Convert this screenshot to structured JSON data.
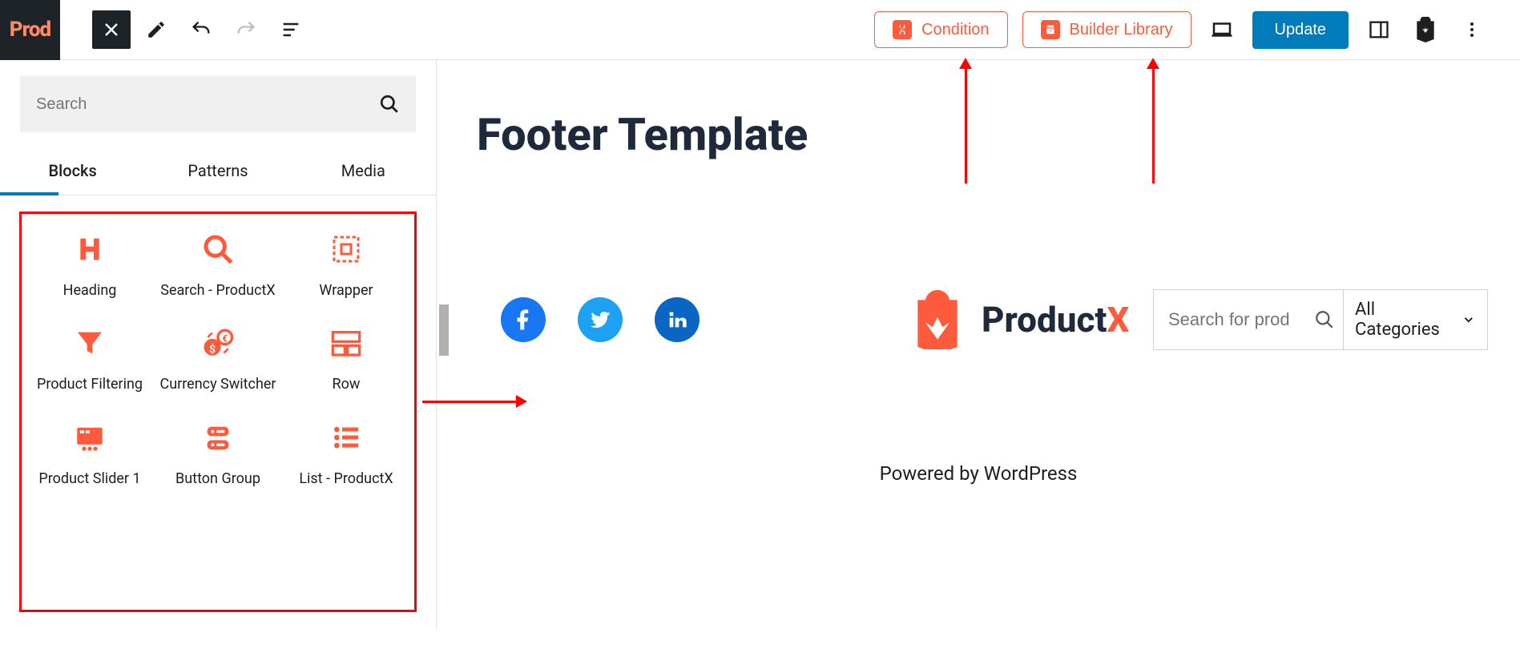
{
  "topbar": {
    "logo_text": "Prod",
    "close_label": "Close",
    "pencil_label": "Edit",
    "undo_label": "Undo",
    "redo_label": "Redo",
    "listview_label": "List view",
    "condition_label": "Condition",
    "library_label": "Builder Library",
    "device_label": "Desktop view",
    "update_label": "Update",
    "settings_label": "Settings",
    "bag_label": "ProductX",
    "more_label": "Options"
  },
  "inserter": {
    "search_placeholder": "Search",
    "tabs": {
      "blocks": "Blocks",
      "patterns": "Patterns",
      "media": "Media"
    },
    "blocks": [
      {
        "label": "Heading",
        "icon": "heading-icon"
      },
      {
        "label": "Search - ProductX",
        "icon": "search-block-icon"
      },
      {
        "label": "Wrapper",
        "icon": "wrapper-icon"
      },
      {
        "label": "Product Filtering",
        "icon": "filter-icon"
      },
      {
        "label": "Currency Switcher",
        "icon": "currency-icon"
      },
      {
        "label": "Row",
        "icon": "row-icon"
      },
      {
        "label": "Product Slider 1",
        "icon": "slider-icon"
      },
      {
        "label": "Button Group",
        "icon": "buttongroup-icon"
      },
      {
        "label": "List - ProductX",
        "icon": "list-icon"
      }
    ]
  },
  "canvas": {
    "title": "Footer Template",
    "brand": "ProductX",
    "search_placeholder": "Search for prod",
    "category_label": "All Categories",
    "powered": "Powered by WordPress"
  }
}
